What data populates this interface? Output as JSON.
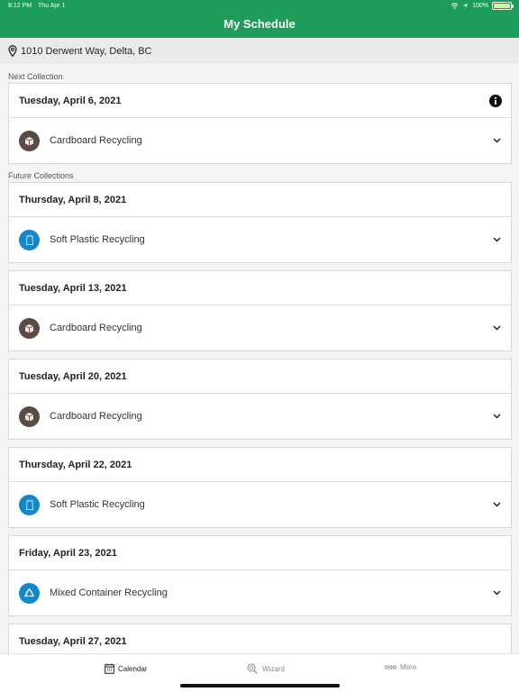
{
  "status_bar": {
    "time": "8:12 PM",
    "date": "Thu Apr 1",
    "battery": "100%"
  },
  "header": {
    "title": "My Schedule"
  },
  "address": {
    "text": "1010 Derwent Way, Delta, BC"
  },
  "sections": {
    "next": "Next Collection",
    "future": "Future Collections"
  },
  "next_collection": {
    "date": "Tuesday, April 6, 2021",
    "type": "Cardboard Recycling",
    "icon": "cardboard-icon"
  },
  "future_collections": [
    {
      "date": "Thursday, April 8, 2021",
      "type": "Soft Plastic Recycling",
      "icon": "soft-plastic-icon"
    },
    {
      "date": "Tuesday, April 13, 2021",
      "type": "Cardboard Recycling",
      "icon": "cardboard-icon"
    },
    {
      "date": "Tuesday, April 20, 2021",
      "type": "Cardboard Recycling",
      "icon": "cardboard-icon"
    },
    {
      "date": "Thursday, April 22, 2021",
      "type": "Soft Plastic Recycling",
      "icon": "soft-plastic-icon"
    },
    {
      "date": "Friday, April 23, 2021",
      "type": "Mixed Container Recycling",
      "icon": "recycle-icon"
    },
    {
      "date": "Tuesday, April 27, 2021"
    }
  ],
  "tabs": {
    "calendar": "Calendar",
    "wizard": "Wizard",
    "more": "More"
  },
  "colors": {
    "header": "#1d9c5a",
    "cardboard": "#5b4a46",
    "plastic": "#1487c9",
    "active_tab": "#222222",
    "inactive_tab": "#8a8a8a"
  }
}
